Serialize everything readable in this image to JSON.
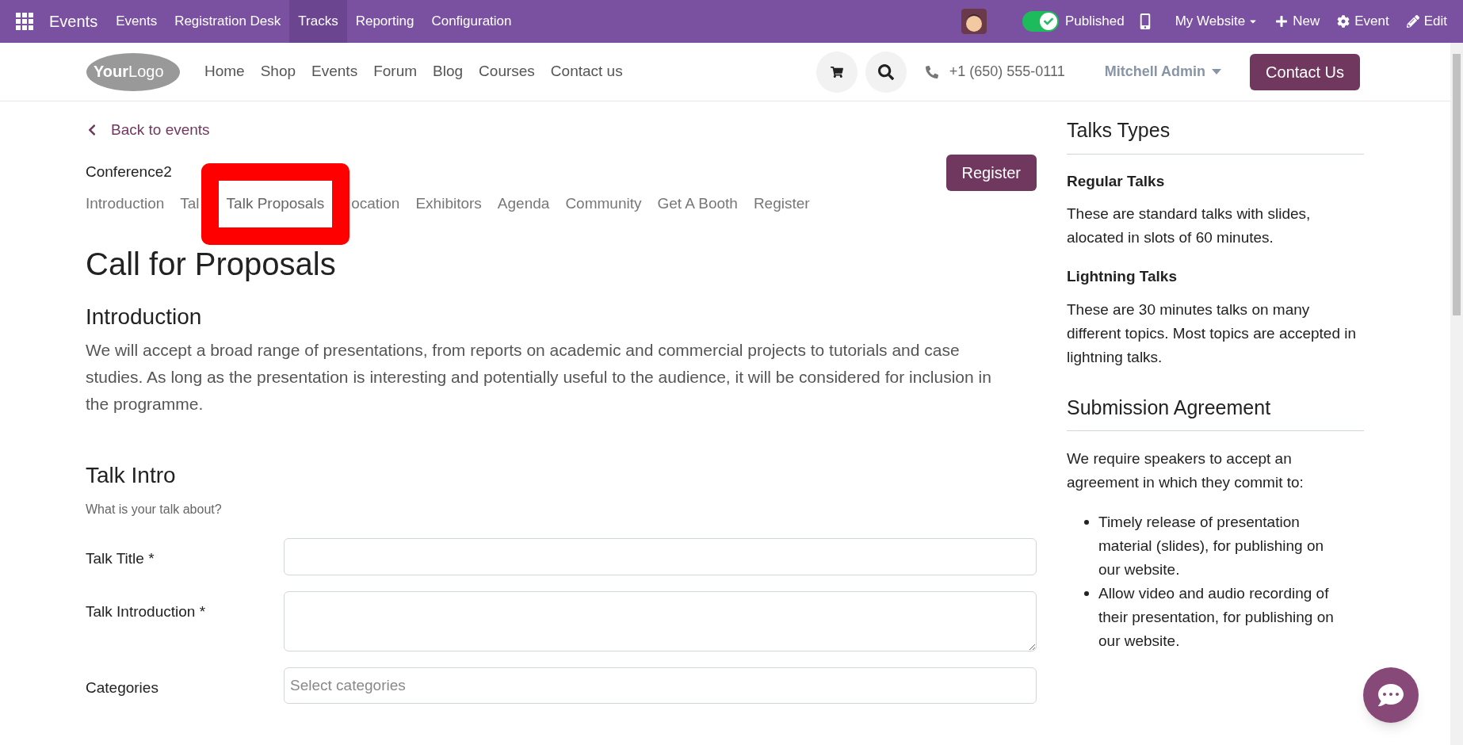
{
  "topbar": {
    "app": "Events",
    "menu": [
      {
        "label": "Events",
        "selected": false
      },
      {
        "label": "Registration Desk",
        "selected": false
      },
      {
        "label": "Tracks",
        "selected": true
      },
      {
        "label": "Reporting",
        "selected": false
      },
      {
        "label": "Configuration",
        "selected": false
      }
    ],
    "published": {
      "label": "Published",
      "on": true
    },
    "website": "My Website",
    "actions": [
      {
        "kind": "new",
        "label": "New"
      },
      {
        "kind": "event",
        "label": "Event"
      },
      {
        "kind": "edit",
        "label": "Edit"
      }
    ]
  },
  "header": {
    "logo": {
      "first": "Your",
      "second": "Logo"
    },
    "nav": [
      "Home",
      "Shop",
      "Events",
      "Forum",
      "Blog",
      "Courses",
      "Contact us"
    ],
    "phone": "+1 (650) 555-0111",
    "user": "Mitchell Admin",
    "cta": "Contact Us"
  },
  "back": "Back to events",
  "event": {
    "name": "Conference2",
    "register": "Register",
    "tabs": [
      {
        "label": "Introduction",
        "highlighted": false
      },
      {
        "label": "Tal",
        "highlighted": false
      },
      {
        "label": "Talk Proposals",
        "highlighted": true
      },
      {
        "label": "ocation",
        "highlighted": false
      },
      {
        "label": "Exhibitors",
        "highlighted": false
      },
      {
        "label": "Agenda",
        "highlighted": false
      },
      {
        "label": "Community",
        "highlighted": false
      },
      {
        "label": "Get A Booth",
        "highlighted": false
      },
      {
        "label": "Register",
        "highlighted": false
      }
    ]
  },
  "page": {
    "title": "Call for Proposals",
    "intro_heading": "Introduction",
    "intro_text": "We will accept a broad range of presentations, from reports on academic and commercial projects to tutorials and case studies. As long as the presentation is interesting and potentially useful to the audience, it will be considered for inclusion in the programme.",
    "form_heading": "Talk Intro",
    "form_hint": "What is your talk about?",
    "fields": [
      {
        "kind": "input",
        "label": "Talk Title *"
      },
      {
        "kind": "textarea",
        "label": "Talk Introduction *"
      },
      {
        "kind": "select",
        "label": "Categories",
        "placeholder": "Select categories"
      }
    ]
  },
  "sidebar": {
    "types_heading": "Talks Types",
    "types": [
      {
        "name": "Regular Talks",
        "text": "These are standard talks with slides, alocated in slots of 60 minutes."
      },
      {
        "name": "Lightning Talks",
        "text": "These are 30 minutes talks on many different topics. Most topics are accepted in lightning talks."
      }
    ],
    "agreement_heading": "Submission Agreement",
    "agreement_text": "We require speakers to accept an agreement in which they commit to:",
    "bullets": [
      "Timely release of presentation material (slides), for publishing on our website.",
      "Allow video and audio recording of their presentation, for publishing on our website."
    ]
  }
}
